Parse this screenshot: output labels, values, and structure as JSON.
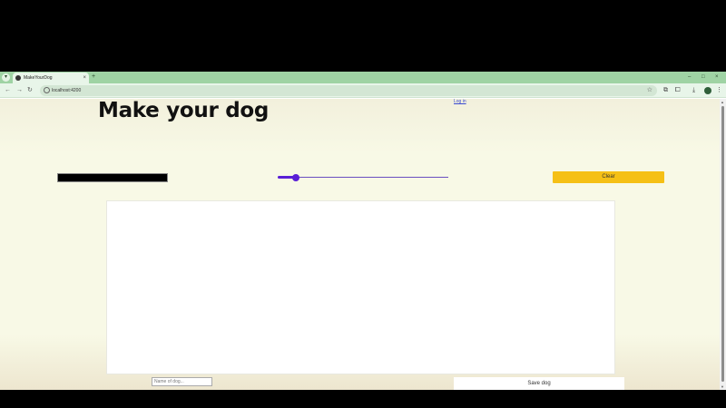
{
  "browser": {
    "tab_title": "MakeYourDog",
    "tab_close": "×",
    "new_tab": "+",
    "url": "localhost:4200",
    "icons": {
      "search_tabs": "chevron-down-icon",
      "back": "back-arrow-icon",
      "forward": "forward-arrow-icon",
      "reload": "reload-icon",
      "site_info": "site-info-icon",
      "bookmark": "star-icon",
      "extensions": "puzzle-icon",
      "download": "download-icon",
      "menu": "more-vert-icon"
    },
    "glyphs": {
      "search_tabs": "▾",
      "back": "←",
      "forward": "→",
      "reload": "↻",
      "star": "☆",
      "split": "⧉",
      "extensions": "⧠",
      "download": "⤓",
      "menu": "⋮",
      "minimize": "–",
      "maximize": "□",
      "close": "×",
      "scroll_up": "▲",
      "scroll_down": "▼"
    }
  },
  "page": {
    "log_link": "Log in",
    "title": "Make your dog",
    "brush_color": "#000000",
    "brush_size": {
      "min": 0,
      "max": 100,
      "value": 9
    },
    "clear_label": "Clear",
    "name_placeholder": "Name of dog...",
    "save_label": "Save dog"
  },
  "colors": {
    "accent": "#f5c016",
    "slider": "#5a1fd6",
    "tab_strip": "#9fd3a4",
    "page_background": "#f8f9e6"
  }
}
